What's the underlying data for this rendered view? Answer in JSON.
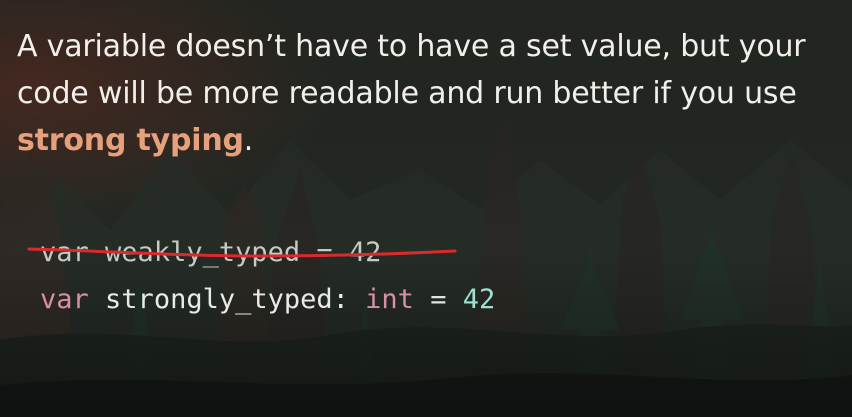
{
  "slide": {
    "text_before": "A variable doesn’t have to have a set value, but your code will be more readable and run better if you use ",
    "highlight": "strong typing",
    "text_after": "."
  },
  "code": {
    "line1": {
      "keyword": "var",
      "name": "weakly_typed",
      "operator": "=",
      "value": "42",
      "struck_out": true
    },
    "line2": {
      "keyword": "var",
      "name": "strongly_typed:",
      "type": "int",
      "operator": "=",
      "value": "42"
    }
  },
  "colors": {
    "highlight": "#e7a07c",
    "strike": "#d92b2b",
    "keyword": "#d98fa8",
    "number": "#9fe0d3"
  }
}
